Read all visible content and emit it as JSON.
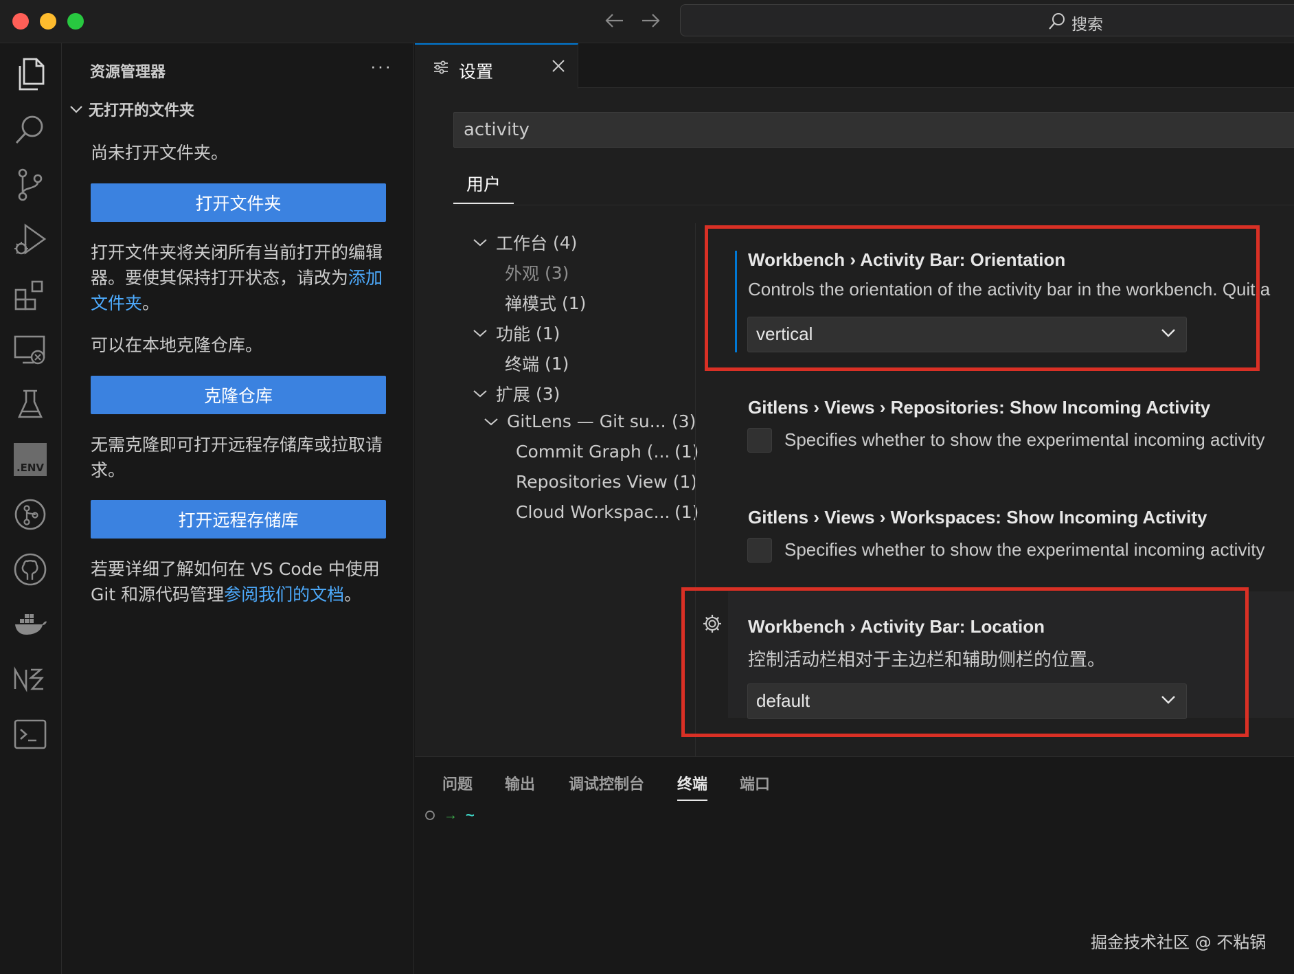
{
  "titlebar": {
    "search_label": "搜索"
  },
  "activity_bar": {
    "env_label": ".ENV"
  },
  "sidebar": {
    "title": "资源管理器",
    "more": "···",
    "section_title": "无打开的文件夹",
    "no_folder_text": "尚未打开文件夹。",
    "open_folder_button": "打开文件夹",
    "close_warning_text": "打开文件夹将关闭所有当前打开的编辑器。要使其保持打开状态，请改为",
    "add_folder_link": "添加文件夹",
    "period": "。",
    "clone_hint": "可以在本地克隆仓库。",
    "clone_button": "克隆仓库",
    "remote_text": "无需克隆即可打开远程存储库或拉取请求。",
    "open_remote_button": "打开远程存储库",
    "learn_text": "若要详细了解如何在 VS Code 中使用 Git 和源代码管理",
    "docs_link": "参阅我们的文档",
    "period2": "。"
  },
  "editor": {
    "tab_label": "设置",
    "search_value": "activity",
    "scope_tab": "用户",
    "toc": [
      {
        "label": "工作台",
        "count": "(4)"
      },
      {
        "label": "外观",
        "count": "(3)"
      },
      {
        "label": "禅模式",
        "count": "(1)"
      },
      {
        "label": "功能",
        "count": "(1)"
      },
      {
        "label": "终端",
        "count": "(1)"
      },
      {
        "label": "扩展",
        "count": "(3)"
      },
      {
        "label": "GitLens — Git su...",
        "count": "(3)"
      },
      {
        "label": "Commit Graph (...",
        "count": "(1)"
      },
      {
        "label": "Repositories View",
        "count": "(1)"
      },
      {
        "label": "Cloud Workspac...",
        "count": "(1)"
      }
    ],
    "settings": [
      {
        "category": "Workbench › Activity Bar: ",
        "name": "Orientation",
        "description": "Controls the orientation of the activity bar in the workbench. Quit a",
        "value": "vertical"
      },
      {
        "category": "Gitlens › Views › Repositories: ",
        "name": "Show Incoming Activity",
        "description": "Specifies whether to show the experimental incoming activity"
      },
      {
        "category": "Gitlens › Views › Workspaces: ",
        "name": "Show Incoming Activity",
        "description": "Specifies whether to show the experimental incoming activity"
      },
      {
        "category": "Workbench › Activity Bar: ",
        "name": "Location",
        "description": "控制活动栏相对于主边栏和辅助侧栏的位置。",
        "value": "default"
      }
    ]
  },
  "panel": {
    "tabs": [
      "问题",
      "输出",
      "调试控制台",
      "终端",
      "端口"
    ],
    "active_tab": "终端",
    "prompt_arrow": "→",
    "prompt_dir": "~"
  },
  "watermark": "掘金技术社区 @ 不粘锅",
  "colors": {
    "accent": "#0078d4",
    "button": "#3b82e0",
    "link": "#4daafc",
    "highlight": "#d93025"
  }
}
